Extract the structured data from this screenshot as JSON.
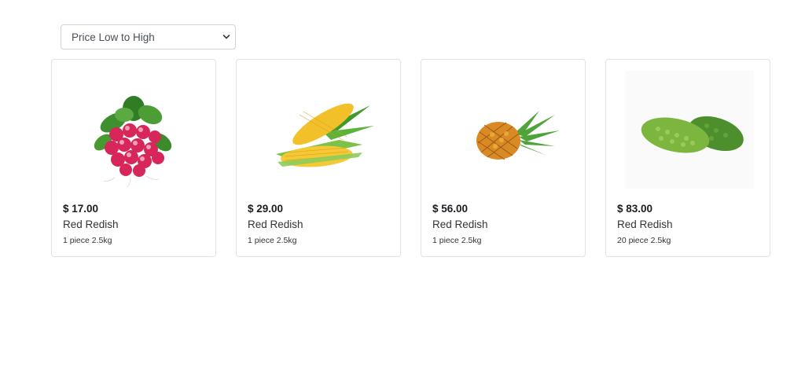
{
  "sort": {
    "selected": "Price Low to High"
  },
  "icons": {
    "select_arrow": "chevron-down-icon"
  },
  "products": [
    {
      "image": "radish-image",
      "price": "$ 17.00",
      "name": "Red Redish",
      "qty": "1 piece 2.5kg"
    },
    {
      "image": "corn-image",
      "price": "$ 29.00",
      "name": "Red Redish",
      "qty": "1 piece 2.5kg"
    },
    {
      "image": "pineapple-image",
      "price": "$ 56.00",
      "name": "Red Redish",
      "qty": "1 piece 2.5kg"
    },
    {
      "image": "bitter-gourd-image",
      "price": "$ 83.00",
      "name": "Red Redish",
      "qty": "20 piece 2.5kg"
    }
  ]
}
